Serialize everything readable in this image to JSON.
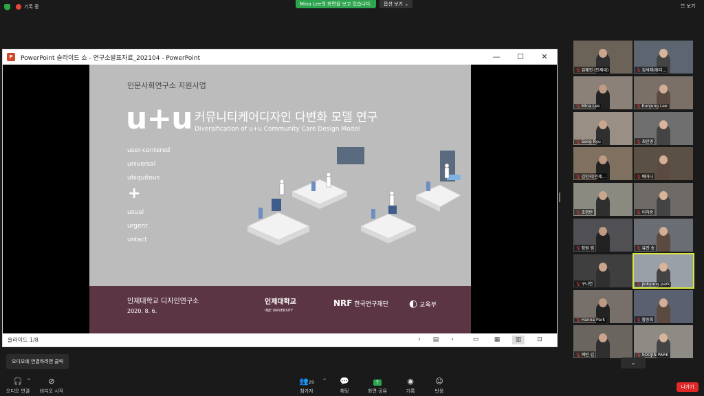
{
  "top": {
    "recording_label": "기록 중",
    "share_banner": "Mina Lee의 화면을 보고 있습니다.",
    "options_label": "옵션 보기 ⌄",
    "view_label": "보기"
  },
  "window": {
    "title": "PowerPoint 슬라이드 쇼  -  연구소발표자료_202104 - PowerPoint",
    "app_logo": "P",
    "min_glyph": "—",
    "max_glyph": "☐",
    "close_glyph": "✕"
  },
  "slide": {
    "top_text": "인문사회연구소 지원사업",
    "logo_text": "u+u",
    "title": "커뮤니티케어디자인 다변화 모델 연구",
    "subtitle": "Diversification of u+u Community Care Design Model",
    "words_top": [
      "user-centered",
      "universal",
      "ubiquitous"
    ],
    "plus": "+",
    "words_bottom": [
      "usual",
      "urgent",
      "untact"
    ],
    "institute": "인제대학교 디자인연구소",
    "date": "2020. 8. 6.",
    "logo_inje": "인제대학교",
    "logo_inje_sub": "INJE UNIVERSITY",
    "logo_nrf": "NRF",
    "logo_nrf_text": "한국연구재단",
    "logo_moe": "교육부"
  },
  "status": {
    "slide_count": "슬라이드 1/8"
  },
  "tooltip": "오디오에 연결하려면 클릭",
  "bottombar": {
    "audio": "오디오 연결",
    "video": "비디오 시작",
    "participants": "참가자",
    "participants_count": "29",
    "chat": "채팅",
    "share": "화면 공유",
    "record": "기록",
    "reactions": "반응",
    "leave": "나가기"
  },
  "participants": [
    {
      "name": "김혜진 (인제대)"
    },
    {
      "name": "김석래(휴티..."
    },
    {
      "name": "Mina Lee"
    },
    {
      "name": "Eunjung Lee"
    },
    {
      "name": "Sang Ryu"
    },
    {
      "name": "최인영"
    },
    {
      "name": "김민지(인제..."
    },
    {
      "name": "배아나"
    },
    {
      "name": "조명란"
    },
    {
      "name": "이하랑"
    },
    {
      "name": "정원 림"
    },
    {
      "name": "유진 송"
    },
    {
      "name": "구나연"
    },
    {
      "name": "jinkyung park"
    },
    {
      "name": "Hanna Park"
    },
    {
      "name": "황승희"
    },
    {
      "name": "예빈 김"
    },
    {
      "name": "SOOJIN PARK"
    }
  ],
  "colors": {
    "slide_bg": "#bcbcbc",
    "slide_footer": "#5c3544",
    "share_green": "#2da44e",
    "leave_red": "#e02828",
    "active_speaker": "#d9e83a"
  }
}
